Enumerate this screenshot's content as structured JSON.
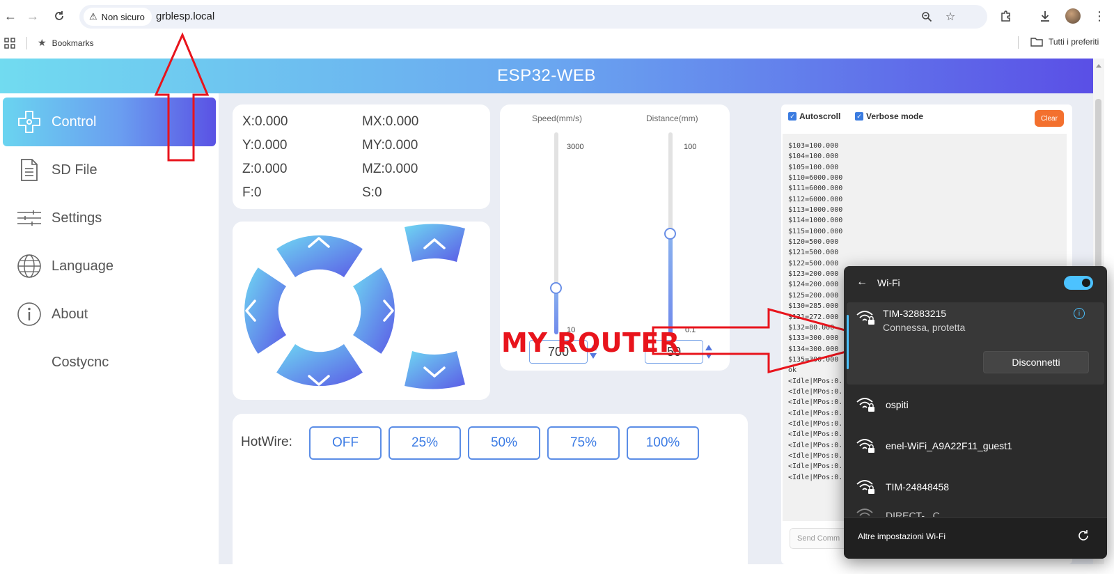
{
  "browser": {
    "security_label": "Non sicuro",
    "url": "grblesp.local",
    "bookmarks_label": "Bookmarks",
    "all_bookmarks_label": "Tutti i preferiti"
  },
  "app": {
    "title": "ESP32-WEB"
  },
  "sidebar": {
    "items": [
      {
        "label": "Control",
        "icon": "control-pad-icon"
      },
      {
        "label": "SD File",
        "icon": "document-icon"
      },
      {
        "label": "Settings",
        "icon": "sliders-icon"
      },
      {
        "label": "Language",
        "icon": "globe-icon"
      },
      {
        "label": "About",
        "icon": "info-icon"
      },
      {
        "label": "Costycnc",
        "icon": ""
      }
    ]
  },
  "position": {
    "x": "X:0.000",
    "y": "Y:0.000",
    "z": "Z:0.000",
    "f": "F:0",
    "mx": "MX:0.000",
    "my": "MY:0.000",
    "mz": "MZ:0.000",
    "s": "S:0"
  },
  "sliders": {
    "speed": {
      "label": "Speed(mm/s)",
      "max_label": "3000",
      "min_label": "10",
      "value": "700",
      "level": 0.23
    },
    "distance": {
      "label": "Distance(mm)",
      "max_label": "100",
      "min_label": "0.1",
      "value": "50",
      "level": 0.5
    }
  },
  "hotwire": {
    "label": "HotWire:",
    "buttons": [
      "OFF",
      "25%",
      "50%",
      "75%",
      "100%"
    ]
  },
  "console": {
    "autoscroll_label": "Autoscroll",
    "verbose_label": "Verbose mode",
    "clear_label": "Clear",
    "send_placeholder": "Send Comm",
    "lines": [
      "$103=100.000",
      "$104=100.000",
      "$105=100.000",
      "$110=6000.000",
      "$111=6000.000",
      "$112=6000.000",
      "$113=1000.000",
      "$114=1000.000",
      "$115=1000.000",
      "$120=500.000",
      "$121=500.000",
      "$122=500.000",
      "$123=200.000",
      "$124=200.000",
      "$125=200.000",
      "$130=285.000",
      "$131=272.000",
      "$132=80.000",
      "$133=300.000",
      "$134=300.000",
      "$135=300.000",
      "ok",
      "<Idle|MPos:0.",
      "<Idle|MPos:0.",
      "<Idle|MPos:0.",
      "<Idle|MPos:0.",
      "<Idle|MPos:0.",
      "<Idle|MPos:0.",
      "<Idle|MPos:0.",
      "<Idle|MPos:0.",
      "<Idle|MPos:0.",
      "<Idle|MPos:0."
    ]
  },
  "annotation": {
    "text": "MY ROUTER",
    "color": "#e8141c"
  },
  "wifi": {
    "title": "Wi-Fi",
    "toggle_on": true,
    "connected": {
      "ssid": "TIM-32883215",
      "status": "Connessa, protetta",
      "disconnect_label": "Disconnetti"
    },
    "networks": [
      "ospiti",
      "enel-WiFi_A9A22F11_guest1",
      "TIM-24848458",
      "DIRECT-...C..."
    ],
    "more_settings_label": "Altre impostazioni Wi-Fi"
  }
}
